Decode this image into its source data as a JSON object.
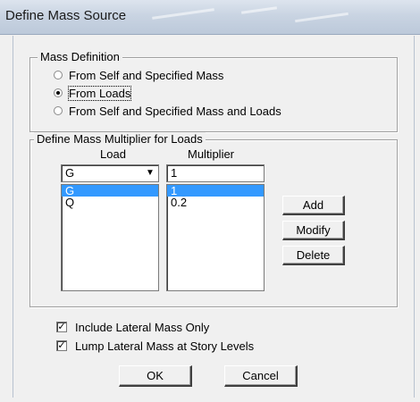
{
  "window": {
    "title": "Define Mass Source"
  },
  "mass_definition": {
    "legend": "Mass Definition",
    "options": [
      {
        "label": "From Self and Specified Mass",
        "checked": false
      },
      {
        "label": "From Loads",
        "checked": true
      },
      {
        "label": "From Self and Specified Mass and Loads",
        "checked": false
      }
    ]
  },
  "multiplier_group": {
    "legend": "Define Mass Multiplier for Loads",
    "load_header": "Load",
    "multiplier_header": "Multiplier",
    "load_select_value": "G",
    "multiplier_input_value": "1",
    "dropdown_icon": "▼",
    "rows": [
      {
        "load": "G",
        "multiplier": "1",
        "selected": true
      },
      {
        "load": "Q",
        "multiplier": "0.2",
        "selected": false
      }
    ],
    "add_label": "Add",
    "modify_label": "Modify",
    "delete_label": "Delete"
  },
  "options": {
    "include_lateral": {
      "label": "Include Lateral Mass Only",
      "checked": true
    },
    "lump_lateral": {
      "label": "Lump Lateral Mass at Story Levels",
      "checked": true
    },
    "check_glyph": "✓"
  },
  "footer": {
    "ok_label": "OK",
    "cancel_label": "Cancel"
  },
  "colors": {
    "selection": "#3399ff",
    "dialog_bg": "#f0f0f0"
  }
}
